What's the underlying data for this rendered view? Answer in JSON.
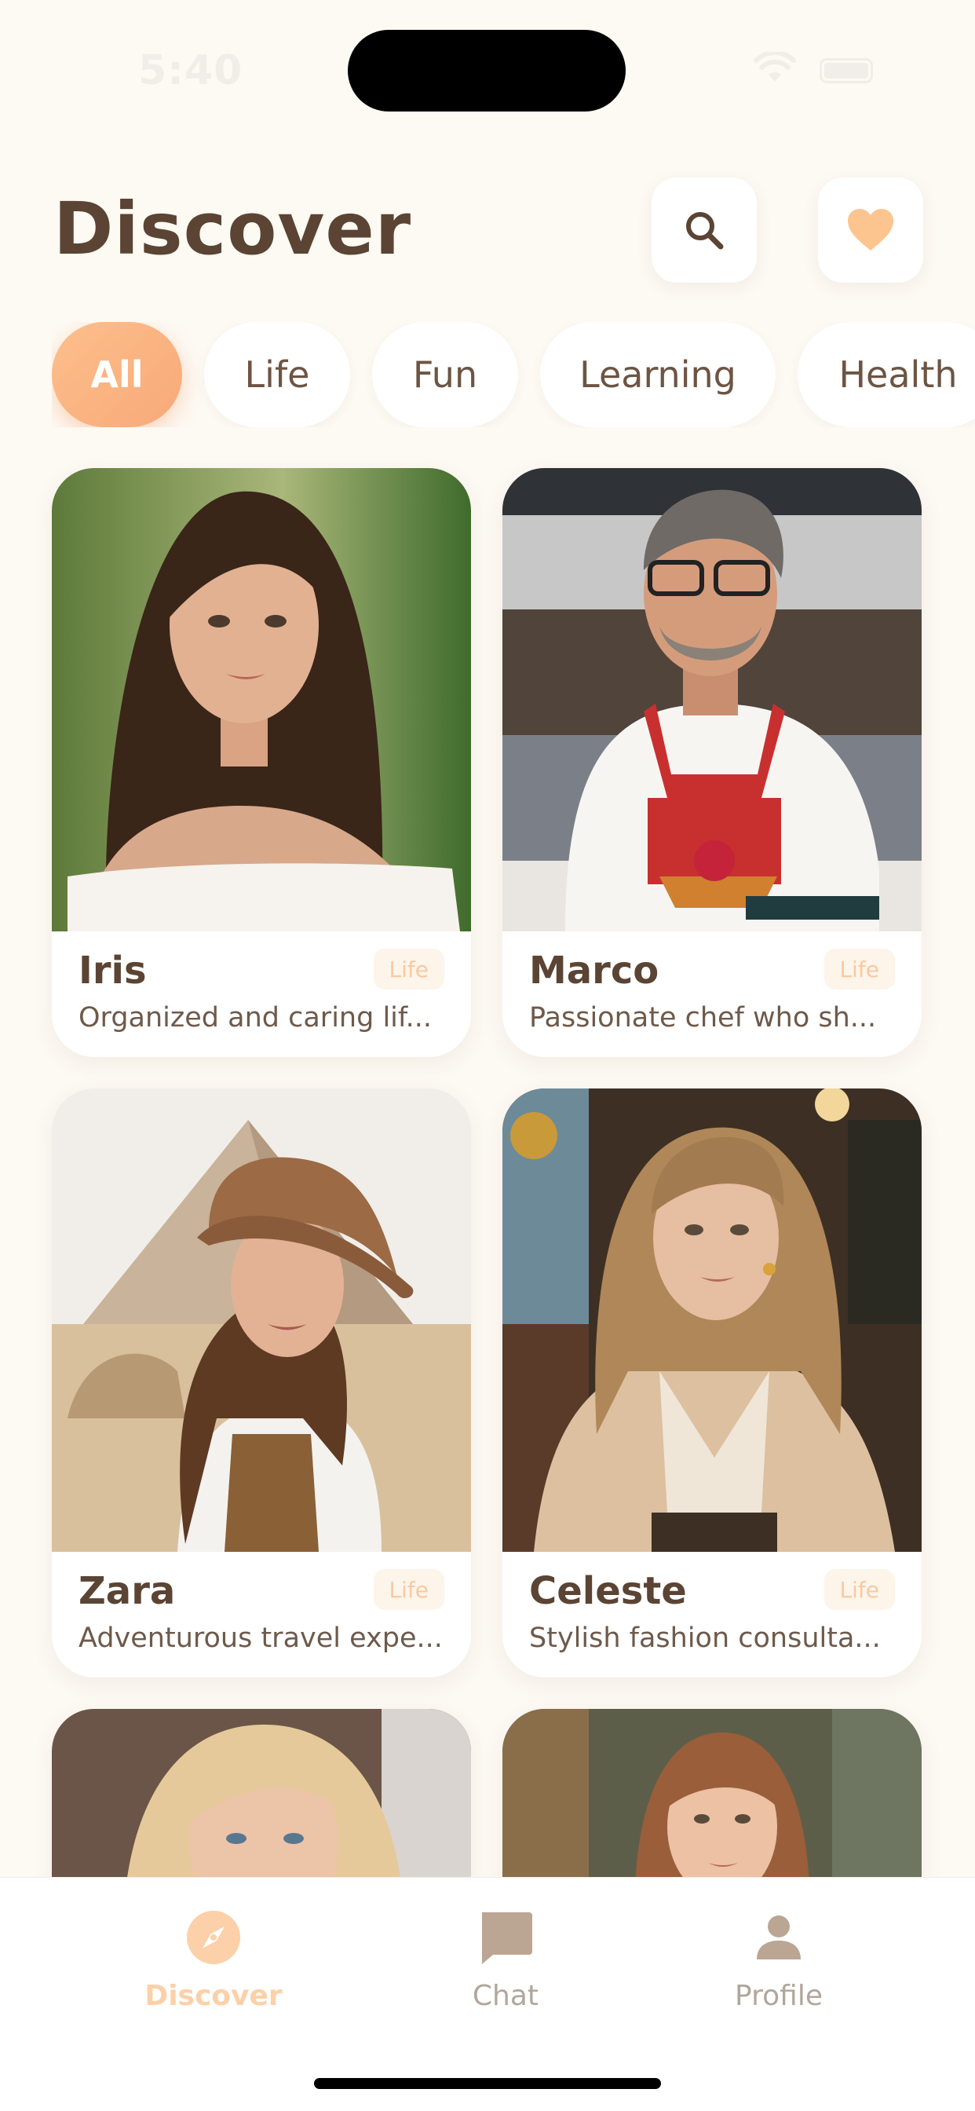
{
  "status_bar": {
    "time": "5:40"
  },
  "header": {
    "title": "Discover"
  },
  "categories": [
    "All",
    "Life",
    "Fun",
    "Learning",
    "Health"
  ],
  "cards": [
    {
      "name": "Iris",
      "tag": "Life",
      "description": "Organized and caring lif..."
    },
    {
      "name": "Marco",
      "tag": "Life",
      "description": "Passionate chef who sh..."
    },
    {
      "name": "Zara",
      "tag": "Life",
      "description": "Adventurous travel expe..."
    },
    {
      "name": "Celeste",
      "tag": "Life",
      "description": "Stylish fashion consulta..."
    }
  ],
  "tabs": [
    {
      "label": "Discover",
      "icon": "compass-icon"
    },
    {
      "label": "Chat",
      "icon": "chat-bubble-icon"
    },
    {
      "label": "Profile",
      "icon": "person-icon"
    }
  ],
  "colors": {
    "background": "#fdf9f3",
    "accent": "#f8a978",
    "heart": "#fcc58f",
    "text_dark": "#5b4433",
    "tab_inactive": "#b2a69b",
    "tag_text": "#f7caa2"
  }
}
